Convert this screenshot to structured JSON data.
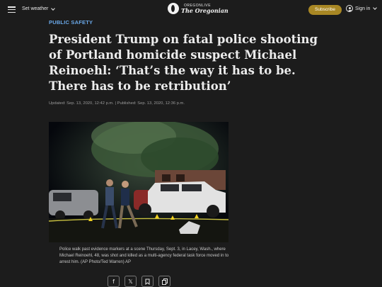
{
  "header": {
    "weather_label": "Set weather",
    "logo_small": "OREGONLIVE",
    "logo_big": "The Oregonian",
    "subscribe_label": "Subscribe",
    "signin_label": "Sign in"
  },
  "article": {
    "section": "PUBLIC SAFETY",
    "headline": "President Trump on fatal police shooting of Portland homicide suspect Michael Reinoehl: ‘That’s the way it has to be. There has to be retribution’",
    "byline": "Updated: Sep. 13, 2020, 12:42 p.m. | Published: Sep. 13, 2020, 12:36 p.m.",
    "caption": "Police walk past evidence markers at a scene Thursday, Sept. 3, in Lacey, Wash., where Michael Reinoehl, 48, was shot and killed as a multi-agency federal task force moved in to arrest him. (AP Photo/Ted Warren) AP"
  },
  "share": {
    "facebook": "f",
    "x": "𝕏",
    "bookmark": "",
    "copy": ""
  },
  "colors": {
    "background": "#1c1c1c",
    "accent_link": "#6aa8e8",
    "subscribe": "#a88724"
  }
}
